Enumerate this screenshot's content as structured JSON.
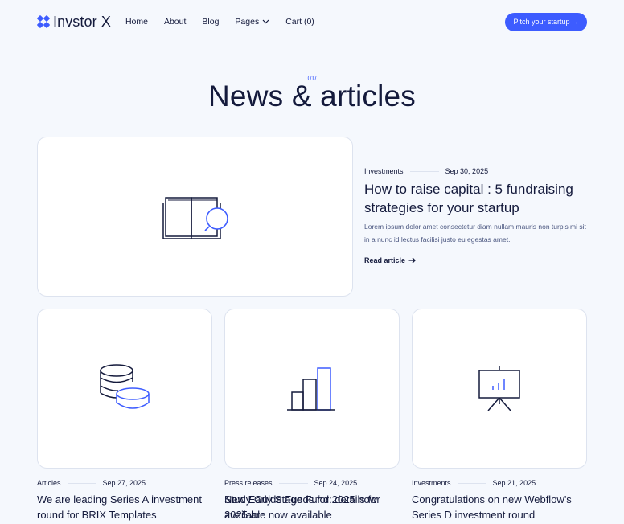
{
  "brand": {
    "name": "Invstor X",
    "logo_icon": "brand-logo-icon",
    "accent": "#3d5cff",
    "text_color": "#141a3c"
  },
  "nav": {
    "links": [
      "Home",
      "About",
      "Blog",
      "Pages",
      "Cart (0)"
    ],
    "cta_label": "Pitch your startup →"
  },
  "section": {
    "eyebrow": "01/",
    "title": "News & articles"
  },
  "featured": {
    "category": "Investments",
    "date": "Sep 30, 2025",
    "title": "How to raise capital : 5 fundraising strategies for your startup",
    "excerpt": "Lorem ipsum dolor amet consectetur diam nullam mauris non turpis mi sit in a nunc id lectus facilisi justo eu egestas amet.",
    "read_more": "Read article",
    "icon": "book-search-icon"
  },
  "articles": [
    {
      "category": "Articles",
      "date": "Sep 27, 2025",
      "title": "We are leading Series A investment round for BRIX Templates",
      "icon": "coins-icon"
    },
    {
      "category": "Press releases",
      "date": "Sep 24, 2025",
      "title": "New Early Stage Fund: details for 2025 are now available",
      "title_overlay": "Study Guide Funds for 2025 now available",
      "icon": "bar-chart-icon"
    },
    {
      "category": "Investments",
      "date": "Sep 21, 2025",
      "title": "Congratulations on new Webflow's Series D investment round",
      "icon": "presentation-board-icon"
    }
  ]
}
